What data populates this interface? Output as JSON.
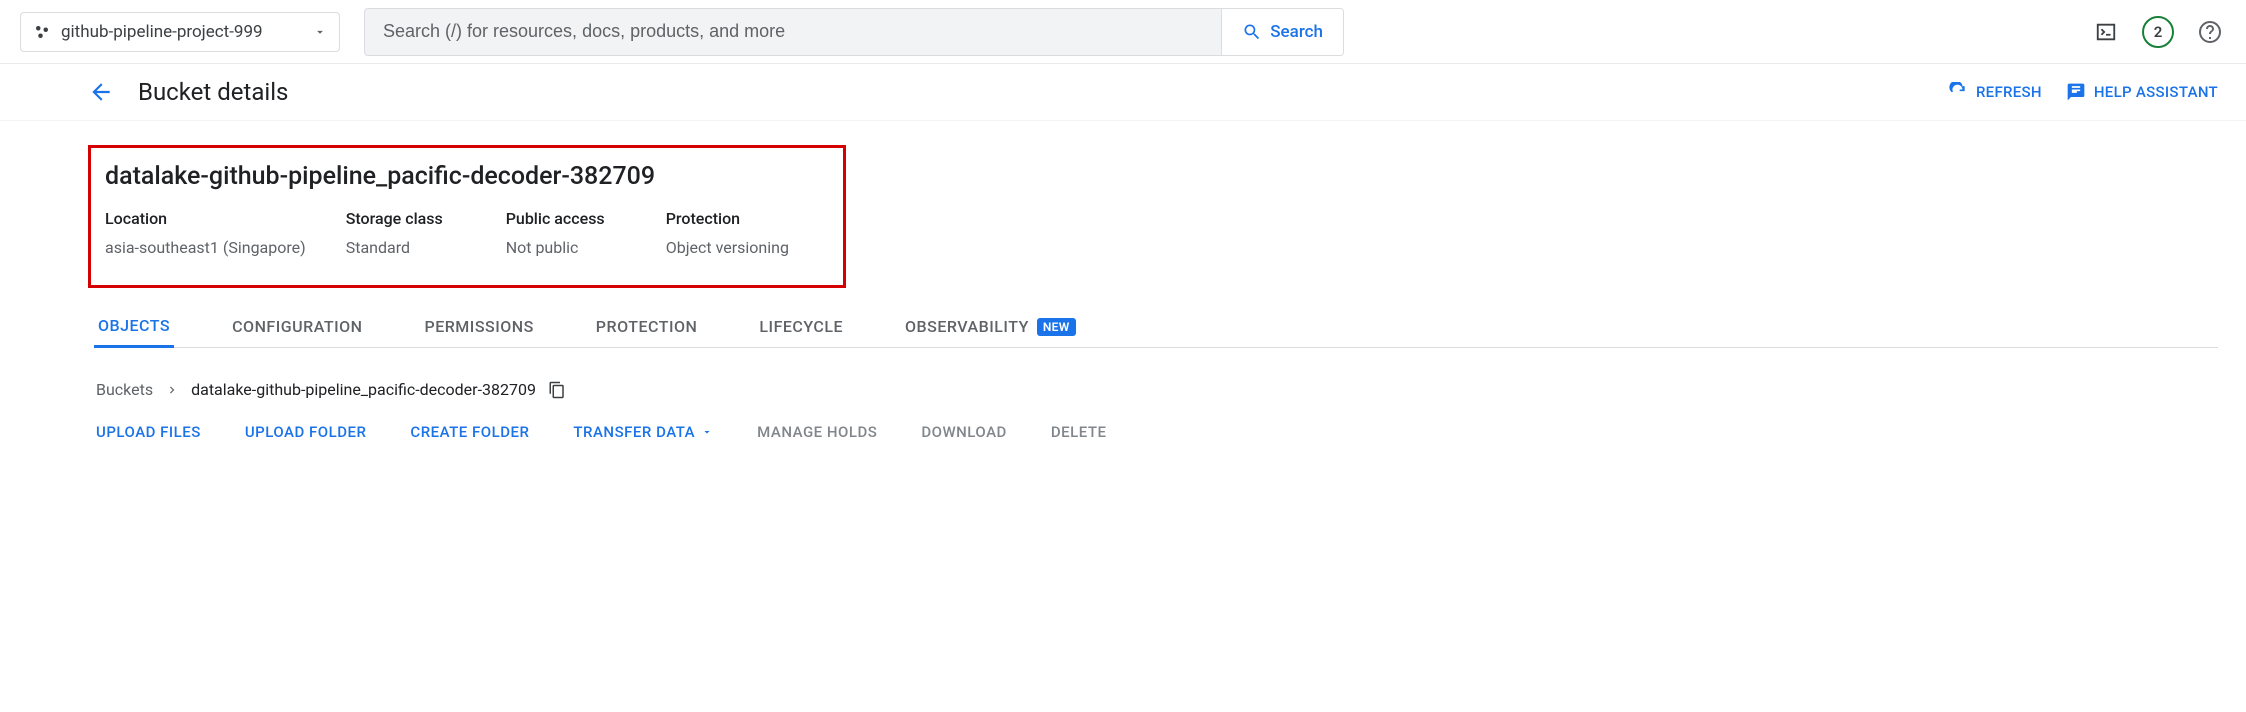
{
  "topbar": {
    "project_name": "github-pipeline-project-999",
    "search_placeholder": "Search (/) for resources, docs, products, and more",
    "search_button_label": "Search",
    "badge_count": "2"
  },
  "header": {
    "title": "Bucket details",
    "refresh_label": "REFRESH",
    "help_label": "HELP ASSISTANT"
  },
  "bucket": {
    "name": "datalake-github-pipeline_pacific-decoder-382709",
    "props": {
      "location": {
        "label": "Location",
        "value": "asia-southeast1 (Singapore)"
      },
      "storage_class": {
        "label": "Storage class",
        "value": "Standard"
      },
      "public_access": {
        "label": "Public access",
        "value": "Not public"
      },
      "protection": {
        "label": "Protection",
        "value": "Object versioning"
      }
    }
  },
  "tabs": {
    "objects": "OBJECTS",
    "configuration": "CONFIGURATION",
    "permissions": "PERMISSIONS",
    "protection": "PROTECTION",
    "lifecycle": "LIFECYCLE",
    "observability": "OBSERVABILITY",
    "new_badge": "NEW"
  },
  "breadcrumb": {
    "root": "Buckets",
    "current": "datalake-github-pipeline_pacific-decoder-382709"
  },
  "toolbar": {
    "upload_files": "UPLOAD FILES",
    "upload_folder": "UPLOAD FOLDER",
    "create_folder": "CREATE FOLDER",
    "transfer_data": "TRANSFER DATA",
    "manage_holds": "MANAGE HOLDS",
    "download": "DOWNLOAD",
    "delete": "DELETE"
  }
}
